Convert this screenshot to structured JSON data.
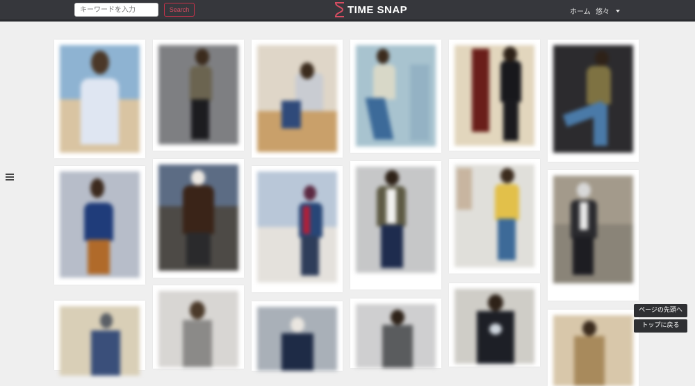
{
  "header": {
    "search_placeholder": "キーワードを入力",
    "search_button": "Search",
    "brand": "TIME SNAP",
    "nav_home": "ホーム",
    "nav_user": "悠々"
  },
  "sidebar_toggle": {
    "icon": "hamburger-menu-icon"
  },
  "floating": {
    "page_top": "ページの先頭へ",
    "back_top": "トップに戻る"
  },
  "colors": {
    "navbar": "#36373c",
    "accent": "#d84d62",
    "page_background": "#efefef"
  }
}
